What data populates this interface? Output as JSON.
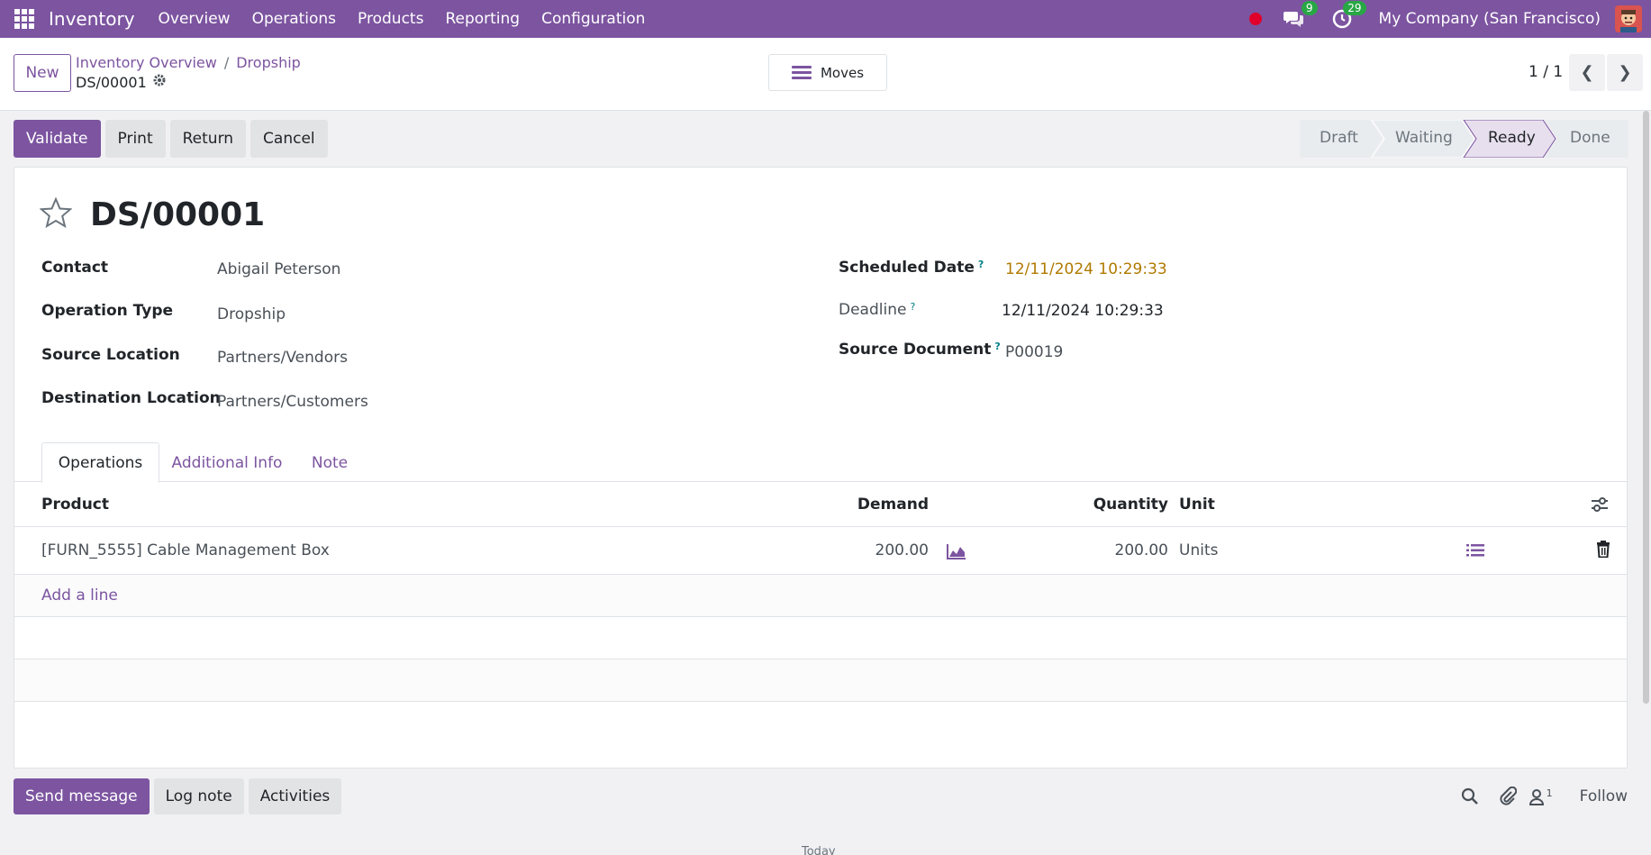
{
  "navbar": {
    "brand": "Inventory",
    "menu": [
      "Overview",
      "Operations",
      "Products",
      "Reporting",
      "Configuration"
    ],
    "messages_count": "9",
    "activities_count": "29",
    "company": "My Company (San Francisco)"
  },
  "control": {
    "new_label": "New",
    "breadcrumb": [
      "Inventory Overview",
      "Dropship"
    ],
    "record_name": "DS/00001",
    "moves_label": "Moves",
    "pager": "1 / 1"
  },
  "actions": {
    "validate": "Validate",
    "print": "Print",
    "return": "Return",
    "cancel": "Cancel"
  },
  "stages": {
    "items": [
      "Draft",
      "Waiting",
      "Ready",
      "Done"
    ],
    "active": "Ready"
  },
  "record": {
    "title": "DS/00001",
    "fields_left": [
      {
        "label": "Contact",
        "value": "Abigail Peterson"
      },
      {
        "label": "Operation Type",
        "value": "Dropship"
      },
      {
        "label": "Source Location",
        "value": "Partners/Vendors"
      },
      {
        "label": "Destination Location",
        "value": "Partners/Customers"
      }
    ],
    "fields_right": [
      {
        "label": "Scheduled Date",
        "value": "12/11/2024 10:29:33",
        "help": "?"
      },
      {
        "label": "Deadline",
        "value": "12/11/2024 10:29:33",
        "help": "?"
      },
      {
        "label": "Source Document",
        "value": "P00019",
        "help": "?"
      }
    ]
  },
  "tabs": [
    "Operations",
    "Additional Info",
    "Note"
  ],
  "table": {
    "headers": {
      "product": "Product",
      "demand": "Demand",
      "quantity": "Quantity",
      "unit": "Unit"
    },
    "rows": [
      {
        "product": "[FURN_5555] Cable Management Box",
        "demand": "200.00",
        "quantity": "200.00",
        "unit": "Units"
      }
    ],
    "add_line": "Add a line"
  },
  "chatter": {
    "send_message": "Send message",
    "log_note": "Log note",
    "activities": "Activities",
    "followers_count": "1",
    "follow": "Follow",
    "today": "Today"
  },
  "colors": {
    "brand": "#7c54a0",
    "warning_date": "#b07a00"
  }
}
